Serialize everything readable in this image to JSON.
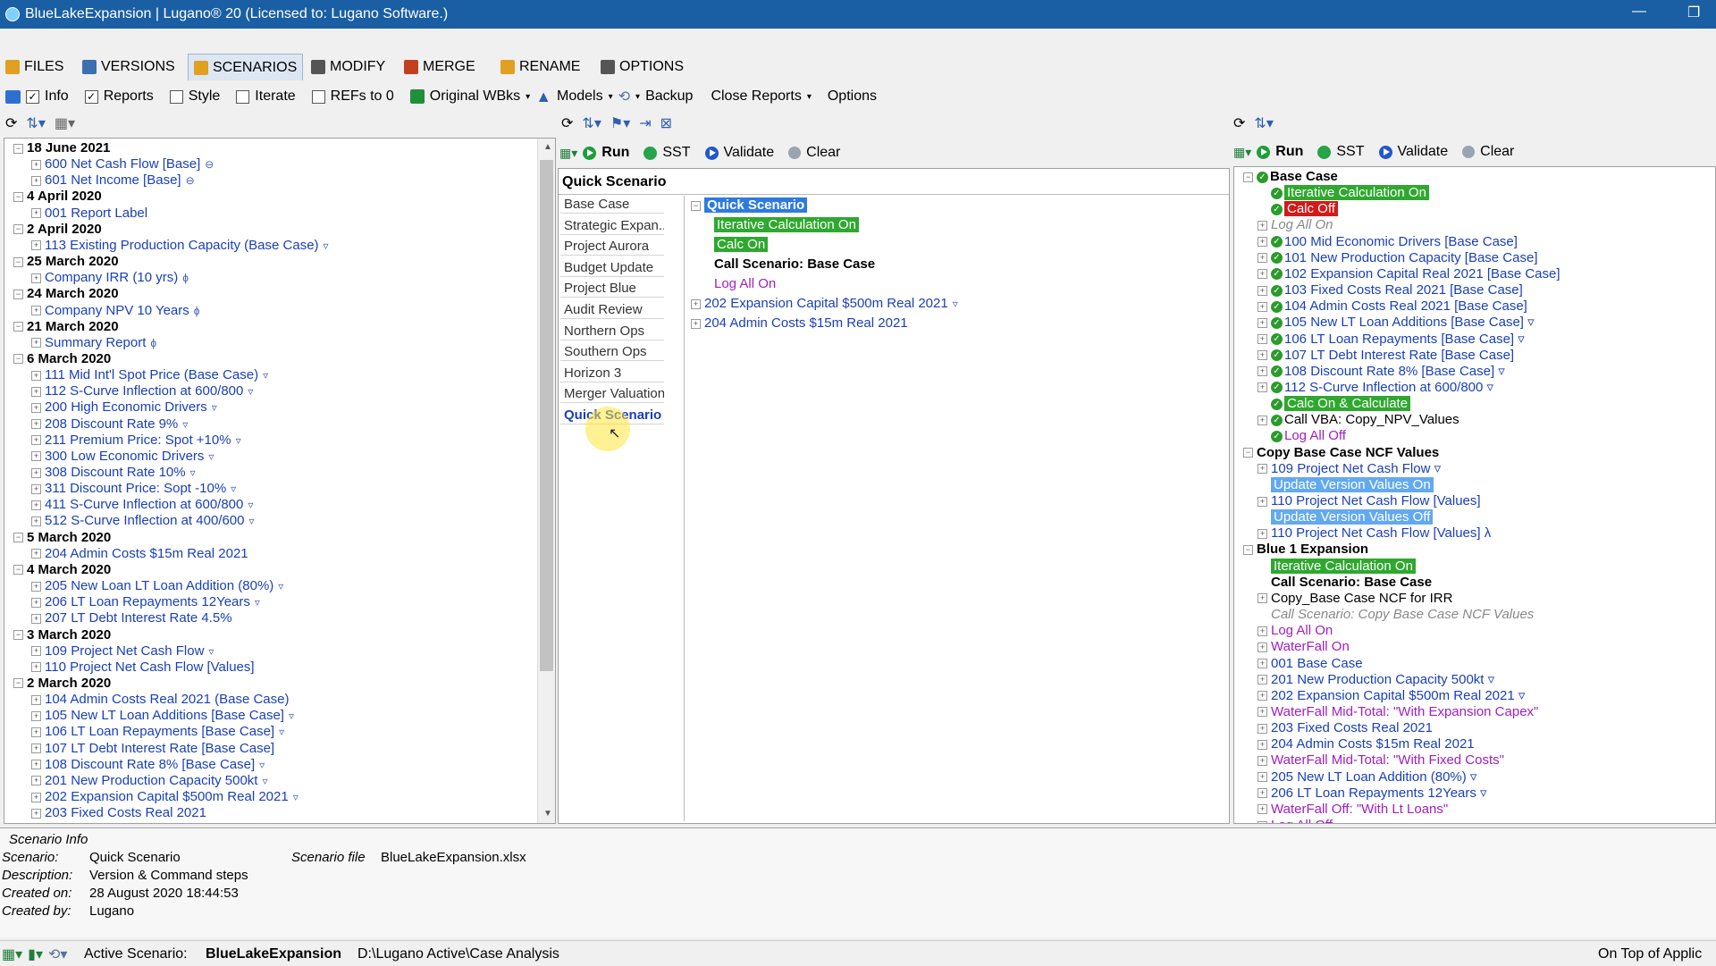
{
  "window": {
    "title": "BlueLakeExpansion  | Lugano® 20 (Licensed to: Lugano Software.)"
  },
  "menu_tabs": [
    {
      "label": "FILES",
      "color": "#e0a020"
    },
    {
      "label": "VERSIONS",
      "color": "#3a6fb0"
    },
    {
      "label": "SCENARIOS",
      "color": "#e0a020"
    },
    {
      "label": "MODIFY",
      "color": "#555555"
    },
    {
      "label": "MERGE",
      "color": "#c04020"
    },
    {
      "label": "RENAME",
      "color": "#e0a020"
    },
    {
      "label": "OPTIONS",
      "color": "#555555"
    }
  ],
  "toolbar": {
    "info_label": "Info",
    "info_checked": true,
    "reports_label": "Reports",
    "reports_checked": true,
    "style_label": "Style",
    "style_checked": false,
    "iterate_label": "Iterate",
    "iterate_checked": false,
    "refs_label": "REFs to 0",
    "refs_checked": false,
    "original_label": "Original WBks",
    "models_label": "Models",
    "backup_label": "Backup",
    "close_reports_label": "Close Reports",
    "options_label": "Options"
  },
  "versions_tree": [
    {
      "kind": "date",
      "text": "18 June 2021"
    },
    {
      "kind": "item",
      "text": "600 Net Cash Flow [Base]",
      "suffix": "⊖"
    },
    {
      "kind": "item",
      "text": "601 Net Income [Base]",
      "suffix": "⊖"
    },
    {
      "kind": "date",
      "text": "4 April 2020"
    },
    {
      "kind": "item",
      "text": "001 Report Label",
      "suffix": ""
    },
    {
      "kind": "date",
      "text": "2 April 2020"
    },
    {
      "kind": "item",
      "text": "113 Existing Production Capacity (Base Case)",
      "suffix": "▿"
    },
    {
      "kind": "date",
      "text": "25 March 2020"
    },
    {
      "kind": "item",
      "text": "Company IRR (10 yrs)",
      "suffix": "ϕ"
    },
    {
      "kind": "date",
      "text": "24 March 2020"
    },
    {
      "kind": "item",
      "text": "Company NPV 10 Years",
      "suffix": "ϕ"
    },
    {
      "kind": "date",
      "text": "21 March 2020"
    },
    {
      "kind": "item",
      "text": "Summary Report",
      "suffix": "ϕ"
    },
    {
      "kind": "date",
      "text": "6 March 2020"
    },
    {
      "kind": "item",
      "text": "111 Mid Int'l Spot Price (Base Case)",
      "suffix": "▿"
    },
    {
      "kind": "item",
      "text": "112 S-Curve Inflection at 600/800",
      "suffix": "▿"
    },
    {
      "kind": "item",
      "text": "200 High Economic Drivers",
      "suffix": "▿"
    },
    {
      "kind": "item",
      "text": "208 Discount Rate 9%",
      "suffix": "▿"
    },
    {
      "kind": "item",
      "text": "211 Premium Price:  Spot +10%",
      "suffix": "▿"
    },
    {
      "kind": "item",
      "text": "300 Low Economic Drivers",
      "suffix": "▿"
    },
    {
      "kind": "item",
      "text": "308 Discount Rate 10%",
      "suffix": "▿"
    },
    {
      "kind": "item",
      "text": "311 Discount Price: Sopt -10%",
      "suffix": "▿"
    },
    {
      "kind": "item",
      "text": "411 S-Curve Inflection at 600/800",
      "suffix": "▿"
    },
    {
      "kind": "item",
      "text": "512 S-Curve Inflection at 400/600",
      "suffix": "▿"
    },
    {
      "kind": "date",
      "text": "5 March 2020"
    },
    {
      "kind": "item",
      "text": "204 Admin Costs $15m Real 2021",
      "suffix": ""
    },
    {
      "kind": "date",
      "text": "4 March 2020"
    },
    {
      "kind": "item",
      "text": "205 New Loan LT Loan Addition (80%)",
      "suffix": "▿"
    },
    {
      "kind": "item",
      "text": "206 LT Loan Repayments 12Years",
      "suffix": "▿"
    },
    {
      "kind": "item",
      "text": "207 LT Debt Interest Rate 4.5%",
      "suffix": ""
    },
    {
      "kind": "date",
      "text": "3 March 2020"
    },
    {
      "kind": "item",
      "text": "109 Project Net Cash Flow",
      "suffix": "▿"
    },
    {
      "kind": "item",
      "text": "110 Project Net Cash Flow [Values]",
      "suffix": ""
    },
    {
      "kind": "date",
      "text": "2 March 2020"
    },
    {
      "kind": "item",
      "text": "104 Admin Costs Real 2021  (Base Case)",
      "suffix": ""
    },
    {
      "kind": "item",
      "text": "105 New LT Loan Additions [Base Case]",
      "suffix": "▿"
    },
    {
      "kind": "item",
      "text": "106 LT Loan Repayments [Base Case]",
      "suffix": "▿"
    },
    {
      "kind": "item",
      "text": "107 LT Debt Interest Rate [Base Case]",
      "suffix": ""
    },
    {
      "kind": "item",
      "text": "108 Discount Rate 8% [Base Case]",
      "suffix": "▿"
    },
    {
      "kind": "item",
      "text": "201 New Production Capacity 500kt",
      "suffix": "▿"
    },
    {
      "kind": "item",
      "text": "202 Expansion Capital $500m Real 2021",
      "suffix": "▿"
    },
    {
      "kind": "item",
      "text": "203 Fixed Costs Real 2021",
      "suffix": ""
    }
  ],
  "middle": {
    "run_label": "Run",
    "sst_label": "SST",
    "validate_label": "Validate",
    "clear_label": "Clear",
    "header": "Quick Scenario",
    "scenarios": [
      "Base Case",
      "Strategic Expan...",
      "Project Aurora",
      "Budget Update",
      "Project Blue",
      "Audit Review",
      "Northern Ops",
      "Southern Ops",
      "Horizon 3",
      "Merger Valuation",
      "Quick Scenario"
    ],
    "selected_scenario": "Quick Scenario",
    "steps": [
      {
        "style": "blue",
        "text": "Quick Scenario",
        "level": 0,
        "pm": "−"
      },
      {
        "style": "green",
        "text": "Iterative Calculation On",
        "level": 1,
        "pm": ""
      },
      {
        "style": "green",
        "text": "Calc On",
        "level": 1,
        "pm": ""
      },
      {
        "style": "bold",
        "text": "Call Scenario: Base Case",
        "level": 1,
        "pm": ""
      },
      {
        "style": "purple",
        "text": "Log All On",
        "level": 1,
        "pm": ""
      },
      {
        "style": "link",
        "text": "202 Expansion Capital $500m Real 2021",
        "level": 0,
        "pm": "+",
        "suffix": "▿"
      },
      {
        "style": "link",
        "text": "204 Admin Costs $15m Real 2021",
        "level": 0,
        "pm": "+",
        "suffix": ""
      }
    ]
  },
  "right": {
    "run_label": "Run",
    "sst_label": "SST",
    "validate_label": "Validate",
    "clear_label": "Clear",
    "steps": [
      {
        "style": "boldhead",
        "text": "Base Case",
        "indent": 0,
        "pm": "−",
        "ok": true
      },
      {
        "style": "green",
        "text": "Iterative Calculation On",
        "indent": 1,
        "pm": "",
        "ok": true
      },
      {
        "style": "red",
        "text": "Calc Off",
        "indent": 1,
        "pm": "",
        "ok": true
      },
      {
        "style": "grey",
        "text": "Log All On",
        "indent": 1,
        "pm": "+",
        "ok": false
      },
      {
        "style": "link",
        "text": "100 Mid Economic Drivers [Base Case]",
        "indent": 1,
        "pm": "+",
        "ok": true
      },
      {
        "style": "link",
        "text": "101 New Production Capacity [Base Case]",
        "indent": 1,
        "pm": "+",
        "ok": true
      },
      {
        "style": "link",
        "text": "102 Expansion Capital Real 2021 [Base Case]",
        "indent": 1,
        "pm": "+",
        "ok": true
      },
      {
        "style": "link",
        "text": "103 Fixed Costs Real 2021 [Base Case]",
        "indent": 1,
        "pm": "+",
        "ok": true
      },
      {
        "style": "link",
        "text": "104 Admin Costs Real 2021  [Base Case]",
        "indent": 1,
        "pm": "+",
        "ok": true
      },
      {
        "style": "link",
        "text": "105 New LT Loan Additions [Base Case] ▿",
        "indent": 1,
        "pm": "+",
        "ok": true
      },
      {
        "style": "link",
        "text": "106 LT Loan Repayments [Base Case] ▿",
        "indent": 1,
        "pm": "+",
        "ok": true
      },
      {
        "style": "link",
        "text": "107 LT Debt Interest Rate [Base Case]",
        "indent": 1,
        "pm": "+",
        "ok": true
      },
      {
        "style": "link",
        "text": "108 Discount Rate 8% [Base Case] ▿",
        "indent": 1,
        "pm": "+",
        "ok": true
      },
      {
        "style": "link",
        "text": "112 S-Curve Inflection at 600/800 ▿",
        "indent": 1,
        "pm": "+",
        "ok": true
      },
      {
        "style": "green",
        "text": "Calc On & Calculate",
        "indent": 1,
        "pm": "",
        "ok": true
      },
      {
        "style": "plain",
        "text": "Call VBA: Copy_NPV_Values",
        "indent": 1,
        "pm": "+",
        "ok": true
      },
      {
        "style": "purple",
        "text": "Log All Off",
        "indent": 1,
        "pm": "",
        "ok": true
      },
      {
        "style": "boldhead",
        "text": "Copy Base Case NCF Values",
        "indent": 0,
        "pm": "−",
        "ok": false
      },
      {
        "style": "link",
        "text": "109 Project Net Cash Flow ▿",
        "indent": 1,
        "pm": "+",
        "ok": false
      },
      {
        "style": "lightblue",
        "text": "Update Version Values On",
        "indent": 1,
        "pm": "",
        "ok": false
      },
      {
        "style": "link",
        "text": "110 Project Net Cash Flow [Values]",
        "indent": 1,
        "pm": "+",
        "ok": false
      },
      {
        "style": "lightblue",
        "text": "Update Version Values Off",
        "indent": 1,
        "pm": "",
        "ok": false
      },
      {
        "style": "link",
        "text": "110 Project Net Cash Flow [Values] λ",
        "indent": 1,
        "pm": "+",
        "ok": false
      },
      {
        "style": "boldhead",
        "text": "Blue 1 Expansion",
        "indent": 0,
        "pm": "−",
        "ok": false
      },
      {
        "style": "green",
        "text": "Iterative Calculation On",
        "indent": 1,
        "pm": "",
        "ok": false
      },
      {
        "style": "bold",
        "text": "Call Scenario: Base Case",
        "indent": 1,
        "pm": "",
        "ok": false
      },
      {
        "style": "plain",
        "text": "Copy_Base Case NCF for IRR",
        "indent": 1,
        "pm": "+",
        "ok": false
      },
      {
        "style": "grey",
        "text": "Call Scenario: Copy Base Case NCF Values",
        "indent": 1,
        "pm": "",
        "ok": false
      },
      {
        "style": "purple",
        "text": "Log All On",
        "indent": 1,
        "pm": "+",
        "ok": false
      },
      {
        "style": "purple",
        "text": "WaterFall On",
        "indent": 1,
        "pm": "+",
        "ok": false
      },
      {
        "style": "link",
        "text": "001 Base Case",
        "indent": 1,
        "pm": "+",
        "ok": false
      },
      {
        "style": "link",
        "text": "201 New Production Capacity 500kt ▿",
        "indent": 1,
        "pm": "+",
        "ok": false
      },
      {
        "style": "link",
        "text": "202 Expansion Capital $500m Real 2021 ▿",
        "indent": 1,
        "pm": "+",
        "ok": false
      },
      {
        "style": "purple",
        "text": "WaterFall Mid-Total: \"With Expansion Capex\"",
        "indent": 1,
        "pm": "+",
        "ok": false
      },
      {
        "style": "link",
        "text": "203 Fixed Costs Real 2021",
        "indent": 1,
        "pm": "+",
        "ok": false
      },
      {
        "style": "link",
        "text": "204 Admin Costs $15m Real 2021",
        "indent": 1,
        "pm": "+",
        "ok": false
      },
      {
        "style": "purple",
        "text": "WaterFall Mid-Total: \"With Fixed Costs\"",
        "indent": 1,
        "pm": "+",
        "ok": false
      },
      {
        "style": "link",
        "text": "205 New LT Loan Addition (80%) ▿",
        "indent": 1,
        "pm": "+",
        "ok": false
      },
      {
        "style": "link",
        "text": "206 LT Loan Repayments 12Years ▿",
        "indent": 1,
        "pm": "+",
        "ok": false
      },
      {
        "style": "purple",
        "text": "WaterFall Off: \"With Lt Loans\"",
        "indent": 1,
        "pm": "+",
        "ok": false
      },
      {
        "style": "purple",
        "text": "Log All Off",
        "indent": 1,
        "pm": "+",
        "ok": false
      }
    ]
  },
  "info": {
    "title": "Scenario Info",
    "scenario_label": "Scenario:",
    "scenario_value": "Quick Scenario",
    "file_label": "Scenario file",
    "file_value": "BlueLakeExpansion.xlsx",
    "description_label": "Description:",
    "description_value": "Version & Command steps",
    "created_on_label": "Created on:",
    "created_on_value": "28 August 2020 18:44:53",
    "created_by_label": "Created by:",
    "created_by_value": "Lugano"
  },
  "status": {
    "active_label": "Active Scenario:",
    "active_value": "BlueLakeExpansion",
    "path": "D:\\Lugano Active\\Case Analysis",
    "right_text": "On Top of Applic"
  }
}
